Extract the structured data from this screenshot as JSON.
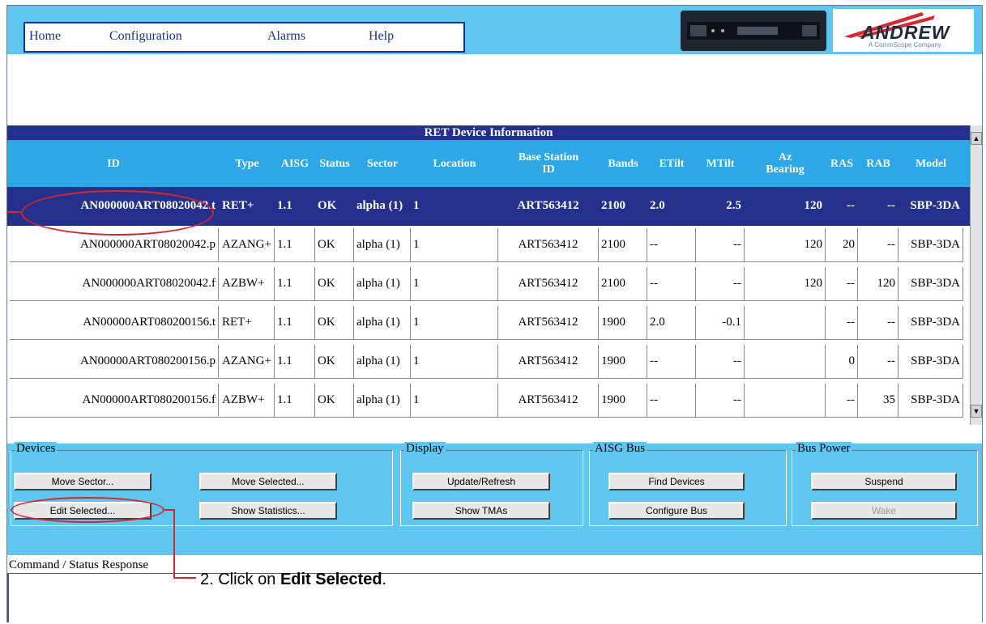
{
  "menu": {
    "items": [
      "Home",
      "Configuration",
      "Alarms",
      "Help"
    ]
  },
  "brand": {
    "name": "ANDREW",
    "tagline": "A CommScope Company"
  },
  "table": {
    "title": "RET Device Information",
    "columns": [
      "ID",
      "Type",
      "AISG",
      "Status",
      "Sector",
      "Location",
      "Base Station ID",
      "Bands",
      "ETilt",
      "MTilt",
      "Az Bearing",
      "RAS",
      "RAB",
      "Model"
    ],
    "rows": [
      {
        "id": "AN000000ART08020042.t",
        "type": "RET+",
        "aisg": "1.1",
        "status": "OK",
        "sector": "alpha (1)",
        "location": "1",
        "bsid": "ART563412",
        "bands": "2100",
        "etilt": "2.0",
        "mtilt": "2.5",
        "az": "120",
        "ras": "--",
        "rab": "--",
        "model": "SBP-3DA"
      },
      {
        "id": "AN000000ART08020042.p",
        "type": "AZANG+",
        "aisg": "1.1",
        "status": "OK",
        "sector": "alpha (1)",
        "location": "1",
        "bsid": "ART563412",
        "bands": "2100",
        "etilt": "--",
        "mtilt": "--",
        "az": "120",
        "ras": "20",
        "rab": "--",
        "model": "SBP-3DA"
      },
      {
        "id": "AN000000ART08020042.f",
        "type": "AZBW+",
        "aisg": "1.1",
        "status": "OK",
        "sector": "alpha (1)",
        "location": "1",
        "bsid": "ART563412",
        "bands": "2100",
        "etilt": "--",
        "mtilt": "--",
        "az": "120",
        "ras": "--",
        "rab": "120",
        "model": "SBP-3DA"
      },
      {
        "id": "AN00000ART080200156.t",
        "type": "RET+",
        "aisg": "1.1",
        "status": "OK",
        "sector": "alpha (1)",
        "location": "1",
        "bsid": "ART563412",
        "bands": "1900",
        "etilt": "2.0",
        "mtilt": "-0.1",
        "az": "",
        "ras": "--",
        "rab": "--",
        "model": "SBP-3DA"
      },
      {
        "id": "AN00000ART080200156.p",
        "type": "AZANG+",
        "aisg": "1.1",
        "status": "OK",
        "sector": "alpha (1)",
        "location": "1",
        "bsid": "ART563412",
        "bands": "1900",
        "etilt": "--",
        "mtilt": "--",
        "az": "",
        "ras": "0",
        "rab": "--",
        "model": "SBP-3DA"
      },
      {
        "id": "AN00000ART080200156.f",
        "type": "AZBW+",
        "aisg": "1.1",
        "status": "OK",
        "sector": "alpha (1)",
        "location": "1",
        "bsid": "ART563412",
        "bands": "1900",
        "etilt": "--",
        "mtilt": "--",
        "az": "",
        "ras": "--",
        "rab": "35",
        "model": "SBP-3DA"
      }
    ]
  },
  "groups": {
    "devices": {
      "label": "Devices",
      "buttons": [
        "Move Sector...",
        "Move Selected...",
        "Edit Selected...",
        "Show Statistics..."
      ]
    },
    "display": {
      "label": "Display",
      "buttons": [
        "Update/Refresh",
        "Show TMAs"
      ]
    },
    "aisg": {
      "label": "AISG Bus",
      "buttons": [
        "Find Devices",
        "Configure Bus"
      ]
    },
    "power": {
      "label": "Bus Power",
      "buttons": [
        "Suspend",
        "Wake"
      ]
    }
  },
  "command": {
    "label": "Command / Status Response"
  },
  "instruction": {
    "prefix": "2.  Click on ",
    "bold": "Edit Selected",
    "suffix": "."
  },
  "colors": {
    "header_blue": "#2ea7e6",
    "navy": "#25308c",
    "panel": "#5ec6ef",
    "annotation": "#d6262c"
  }
}
